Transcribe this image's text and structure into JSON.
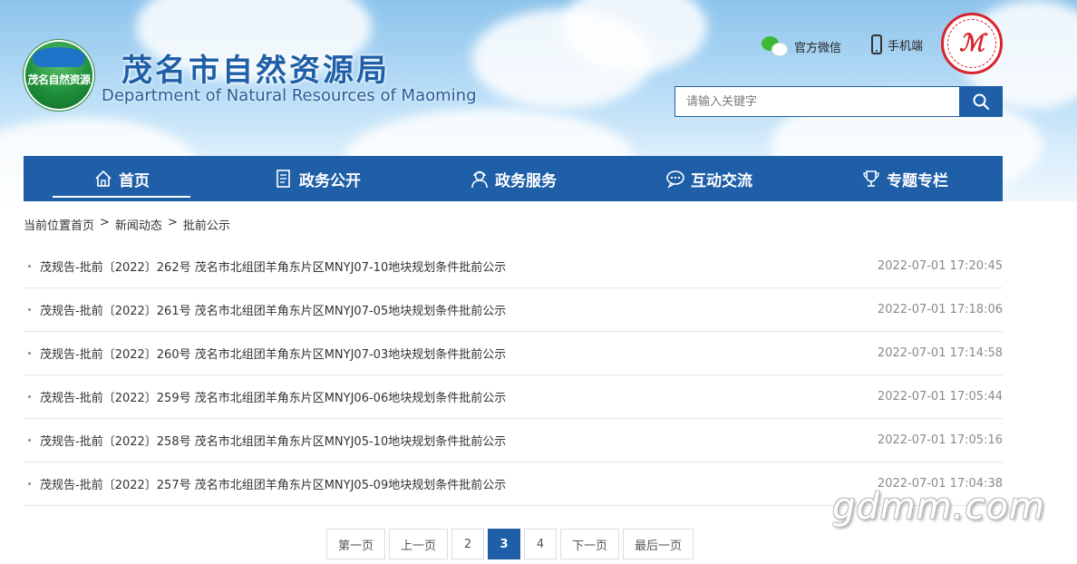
{
  "header": {
    "logo_text": "茂名自然资源",
    "title": "茂名市自然资源局",
    "subtitle": "Department of Natural Resources of Maoming",
    "wechat_label": "官方微信",
    "mobile_label": "手机端",
    "search_placeholder": "请输入关键字"
  },
  "nav": {
    "items": [
      {
        "label": "首页",
        "icon": "home-icon"
      },
      {
        "label": "政务公开",
        "icon": "document-icon"
      },
      {
        "label": "政务服务",
        "icon": "service-person-icon"
      },
      {
        "label": "互动交流",
        "icon": "chat-icon"
      },
      {
        "label": "专题专栏",
        "icon": "trophy-icon"
      }
    ],
    "active": "首页"
  },
  "breadcrumb": {
    "items": [
      "当前位置首页",
      ">",
      "新闻动态",
      ">",
      "批前公示"
    ]
  },
  "list": [
    {
      "title": "茂规告-批前〔2022〕262号 茂名市北组团羊角东片区MNYJ07-10地块规划条件批前公示",
      "date": "2022-07-01 17:20:45"
    },
    {
      "title": "茂规告-批前〔2022〕261号 茂名市北组团羊角东片区MNYJ07-05地块规划条件批前公示",
      "date": "2022-07-01 17:18:06"
    },
    {
      "title": "茂规告-批前〔2022〕260号 茂名市北组团羊角东片区MNYJ07-03地块规划条件批前公示",
      "date": "2022-07-01 17:14:58"
    },
    {
      "title": "茂规告-批前〔2022〕259号 茂名市北组团羊角东片区MNYJ06-06地块规划条件批前公示",
      "date": "2022-07-01 17:05:44"
    },
    {
      "title": "茂规告-批前〔2022〕258号 茂名市北组团羊角东片区MNYJ05-10地块规划条件批前公示",
      "date": "2022-07-01 17:05:16"
    },
    {
      "title": "茂规告-批前〔2022〕257号 茂名市北组团羊角东片区MNYJ05-09地块规划条件批前公示",
      "date": "2022-07-01 17:04:38"
    }
  ],
  "pager": {
    "first": "第一页",
    "prev": "上一页",
    "pages": [
      "2",
      "3",
      "4"
    ],
    "current": "3",
    "next": "下一页",
    "last": "最后一页"
  },
  "watermark": "gdmm.com",
  "colors": {
    "primary": "#1e5fa8",
    "stamp_red": "#d9232d",
    "wechat_green": "#3fb836"
  }
}
